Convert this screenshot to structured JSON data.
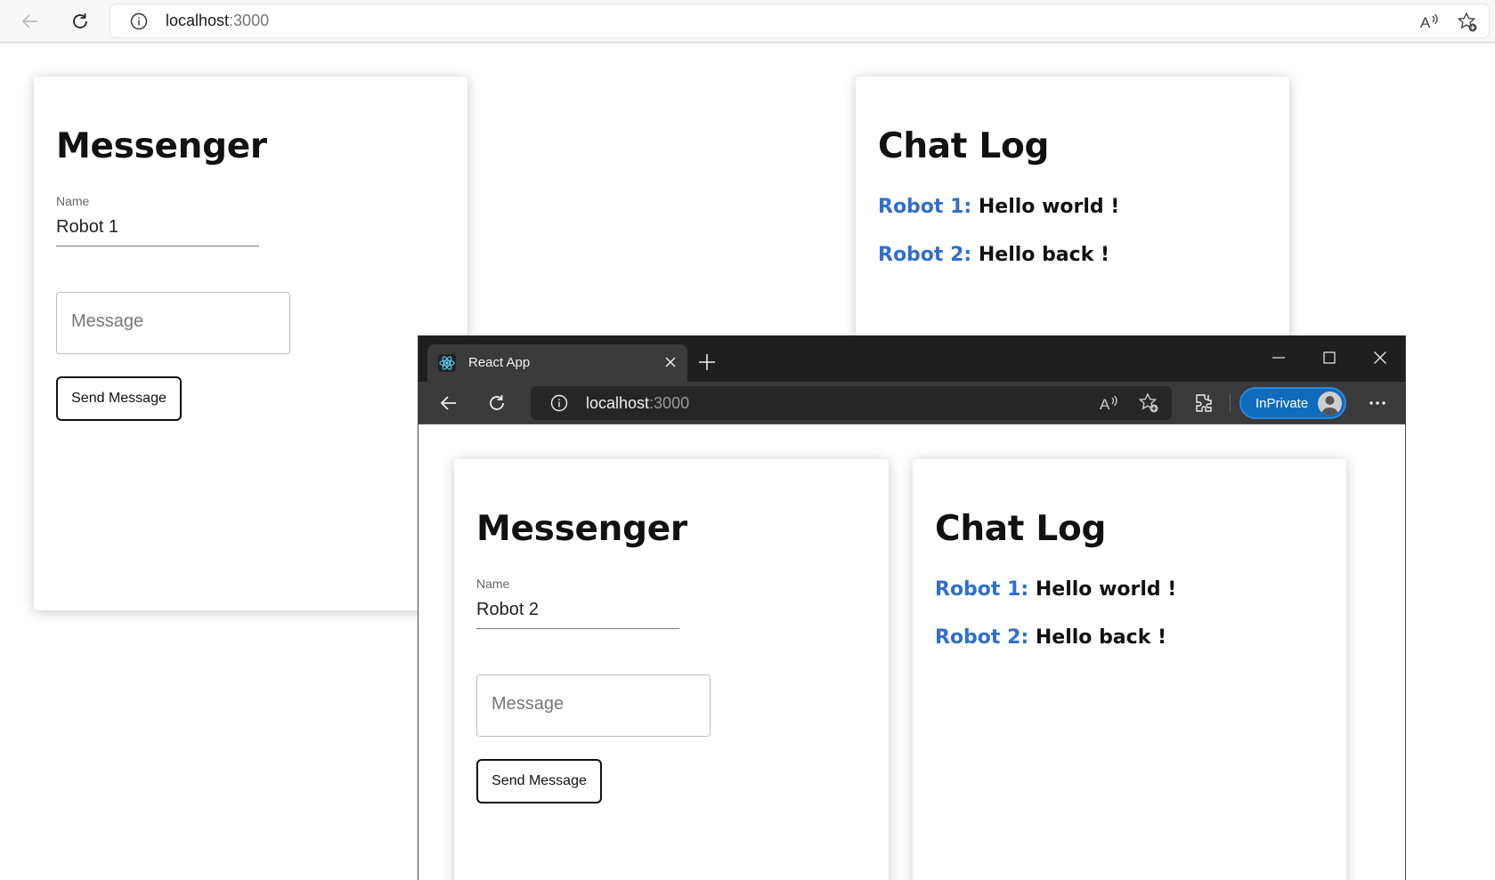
{
  "back_browser": {
    "url_host": "localhost",
    "url_port": ":3000",
    "messenger": {
      "title": "Messenger",
      "name_label": "Name",
      "name_value": "Robot 1",
      "message_placeholder": "Message",
      "send_label": "Send Message"
    },
    "chat_log": {
      "title": "Chat Log",
      "messages": [
        {
          "author": "Robot 1:",
          "text": "Hello world !"
        },
        {
          "author": "Robot 2:",
          "text": "Hello back !"
        }
      ]
    }
  },
  "front_browser": {
    "tab_title": "React App",
    "url_host": "localhost",
    "url_port": ":3000",
    "inprivate_label": "InPrivate",
    "messenger": {
      "title": "Messenger",
      "name_label": "Name",
      "name_value": "Robot 2",
      "message_placeholder": "Message",
      "send_label": "Send Message"
    },
    "chat_log": {
      "title": "Chat Log",
      "messages": [
        {
          "author": "Robot 1:",
          "text": "Hello world !"
        },
        {
          "author": "Robot 2:",
          "text": "Hello back !"
        }
      ]
    }
  },
  "colors": {
    "author_accent": "#2f6fd0",
    "inprivate_badge": "#0f6cbd",
    "dark_chrome": "#1f1f1f"
  }
}
